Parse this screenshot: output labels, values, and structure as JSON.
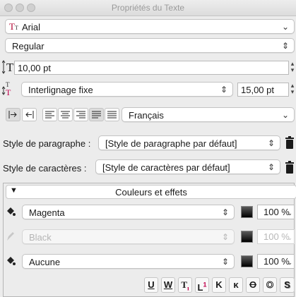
{
  "window": {
    "title": "Propriétés du Texte"
  },
  "font": {
    "family": "Arial",
    "style": "Regular"
  },
  "size": {
    "value": "10,00 pt"
  },
  "spacing": {
    "mode": "Interlignage fixe",
    "value": "15,00 pt"
  },
  "paragraph": {
    "language": "Français"
  },
  "styles": {
    "paragraph_label": "Style de paragraphe :",
    "paragraph_value": "[Style de paragraphe par défaut]",
    "character_label": "Style de caractères :",
    "character_value": "[Style de caractères par défaut]"
  },
  "colors": {
    "title": "Couleurs et effets",
    "text_fill": {
      "name": "Magenta",
      "opacity": "100 %"
    },
    "stroke": {
      "name": "Black",
      "opacity": "100 %"
    },
    "highlight": {
      "name": "Aucune",
      "opacity": "100 %"
    }
  },
  "effects": {
    "underline": "U",
    "word_underline": "W",
    "superscript_glyph": "1",
    "kapitalchen": "K",
    "small_k": "κ",
    "strike": "O",
    "outline": "O",
    "shadow": "S"
  },
  "accent": {
    "magenta": "#c0004b",
    "trash": "#1a1a1a"
  }
}
